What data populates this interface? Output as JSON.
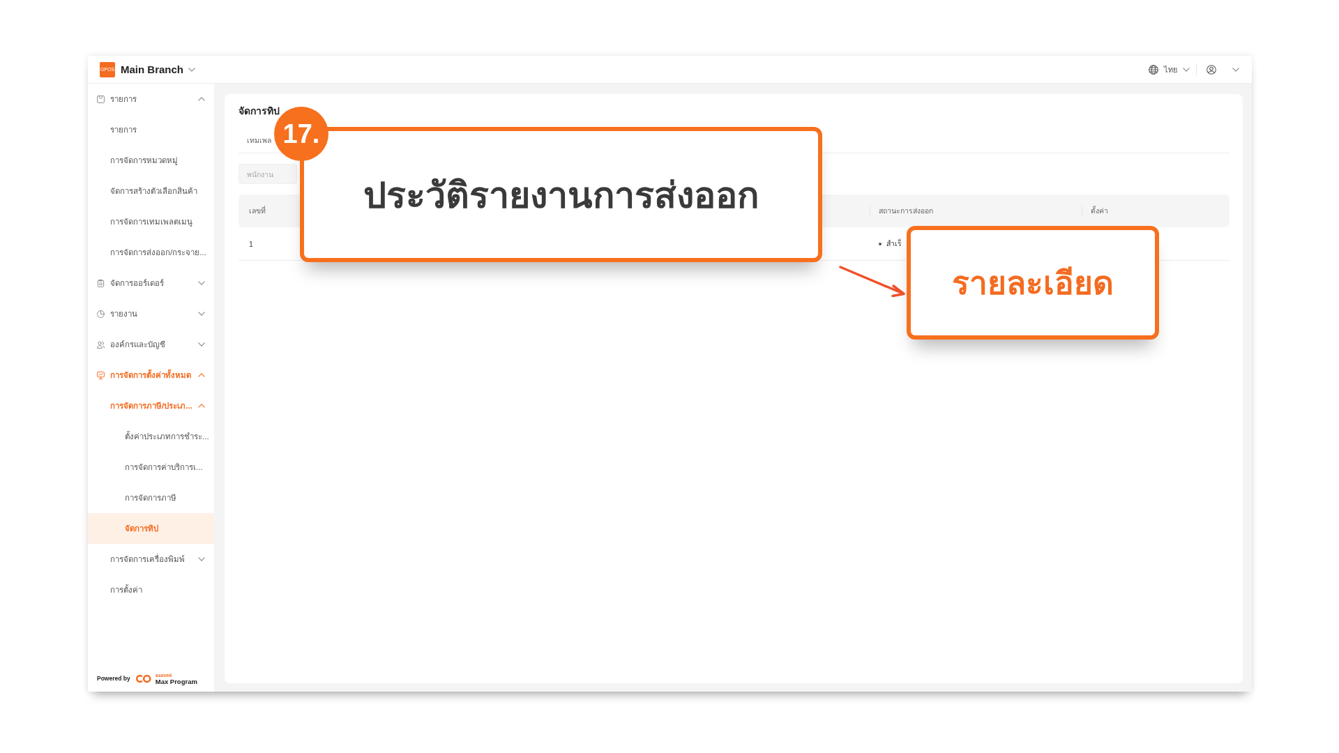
{
  "header": {
    "logo_text": "GPOS",
    "branch": "Main Branch",
    "language": "ไทย"
  },
  "sidebar": {
    "items": [
      {
        "label": "รายการ",
        "selected": false,
        "expanded": true,
        "children": [
          {
            "label": "รายการ",
            "selected": false
          },
          {
            "label": "การจัดการหมวดหมู่",
            "selected": false
          },
          {
            "label": "จัดการสร้างตัวเลือกสินค้า",
            "selected": false
          },
          {
            "label": "การจัดการเทมเพลตเมนู",
            "selected": false
          },
          {
            "label": "การจัดการส่งออก/กระจาย...",
            "selected": false
          }
        ]
      },
      {
        "label": "จัดการออร์เดอร์",
        "selected": false,
        "expanded": false
      },
      {
        "label": "รายงาน",
        "selected": false,
        "expanded": false
      },
      {
        "label": "องค์กรและบัญชี",
        "selected": false,
        "expanded": false
      },
      {
        "label": "การจัดการตั้งค่าทั้งหมด",
        "selected": false,
        "expanded": true,
        "children": [
          {
            "label": "การจัดการภาษี/ประเภ...",
            "selected": false,
            "expanded": true,
            "children": [
              {
                "label": "ตั้งค่าประเภทการชำระ...",
                "selected": false
              },
              {
                "label": "การจัดการค่าบริการเ...",
                "selected": false
              },
              {
                "label": "การจัดการภาษี",
                "selected": false
              },
              {
                "label": "จัดการทิป",
                "selected": true
              }
            ]
          },
          {
            "label": "การจัดการเครื่องพิมพ์",
            "selected": false,
            "expanded": false
          },
          {
            "label": "การตั้งค่า",
            "selected": false
          }
        ]
      }
    ],
    "footer": {
      "powered_by": "Powered by",
      "brand_small": "sunmi",
      "brand": "Max Program"
    }
  },
  "page": {
    "title": "จัดการทิป",
    "tabs": [
      {
        "label": "เทมเพล",
        "selected": false
      }
    ],
    "filter": {
      "placeholder": "พนักงาน"
    },
    "table": {
      "columns": [
        "เลขที่",
        "สถานะการส่งออก",
        "ตั้งค่า"
      ],
      "rows": [
        {
          "number": "1",
          "status": "สำเร็"
        }
      ]
    }
  },
  "annotations": {
    "step": "17.",
    "callouts": [
      {
        "kind": "title",
        "text": "ประวัติรายงานการส่งออก"
      },
      {
        "kind": "highlight",
        "text": "รายละเอียด"
      }
    ]
  }
}
